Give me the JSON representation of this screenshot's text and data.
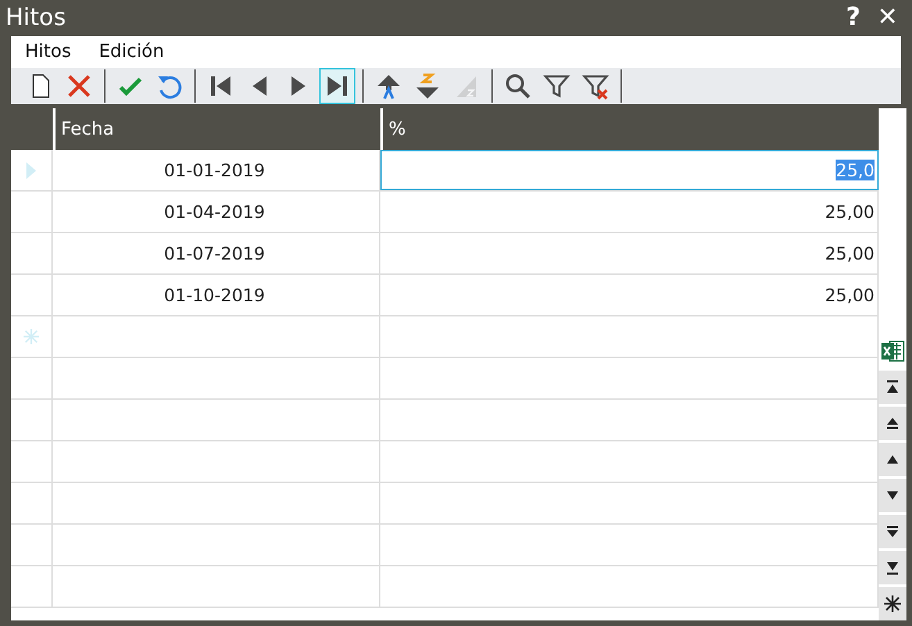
{
  "window": {
    "title": "Hitos",
    "help": "?",
    "close": "✕"
  },
  "menu": [
    {
      "label": "Hitos"
    },
    {
      "label": "Edición"
    }
  ],
  "toolbar": [
    {
      "kind": "new",
      "selected": false,
      "disabled": false
    },
    {
      "kind": "delete",
      "selected": false,
      "disabled": false
    },
    {
      "kind": "sep"
    },
    {
      "kind": "confirm",
      "selected": false,
      "disabled": false
    },
    {
      "kind": "undo",
      "selected": false,
      "disabled": false
    },
    {
      "kind": "sep"
    },
    {
      "kind": "first",
      "selected": false,
      "disabled": false
    },
    {
      "kind": "prev",
      "selected": false,
      "disabled": false
    },
    {
      "kind": "next",
      "selected": false,
      "disabled": false
    },
    {
      "kind": "last",
      "selected": true,
      "disabled": false
    },
    {
      "kind": "sep"
    },
    {
      "kind": "sort-asc",
      "selected": false,
      "disabled": false
    },
    {
      "kind": "sort-desc",
      "selected": false,
      "disabled": false
    },
    {
      "kind": "sort-clear",
      "selected": false,
      "disabled": true
    },
    {
      "kind": "sep"
    },
    {
      "kind": "search",
      "selected": false,
      "disabled": false
    },
    {
      "kind": "filter",
      "selected": false,
      "disabled": false
    },
    {
      "kind": "filter-clear",
      "selected": false,
      "disabled": false
    },
    {
      "kind": "sep"
    }
  ],
  "table": {
    "columns": [
      "Fecha",
      "%"
    ],
    "rows": [
      {
        "kind": "current",
        "cells": [
          {
            "text": "01-01-2019",
            "selected": false
          },
          {
            "text": "25,0",
            "selected": true
          }
        ]
      },
      {
        "kind": "data",
        "cells": [
          {
            "text": "01-04-2019",
            "selected": false
          },
          {
            "text": "25,00",
            "selected": false
          }
        ]
      },
      {
        "kind": "data",
        "cells": [
          {
            "text": "01-07-2019",
            "selected": false
          },
          {
            "text": "25,00",
            "selected": false
          }
        ]
      },
      {
        "kind": "data",
        "cells": [
          {
            "text": "01-10-2019",
            "selected": false
          },
          {
            "text": "25,00",
            "selected": false
          }
        ]
      },
      {
        "kind": "new",
        "cells": []
      }
    ]
  },
  "side_buttons": [
    {
      "kind": "excel"
    },
    {
      "kind": "top"
    },
    {
      "kind": "page-up"
    },
    {
      "kind": "up"
    },
    {
      "kind": "down"
    },
    {
      "kind": "page-down"
    },
    {
      "kind": "bottom"
    },
    {
      "kind": "new"
    }
  ]
}
